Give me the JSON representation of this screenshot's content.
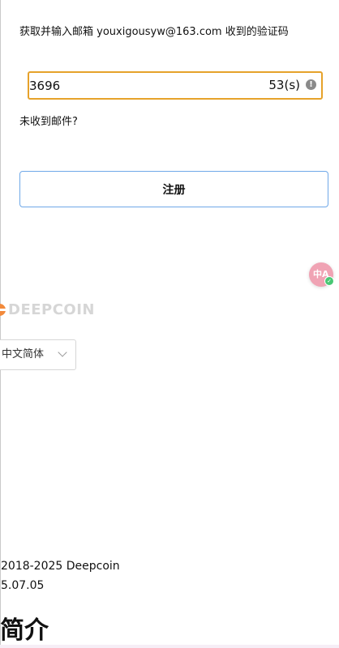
{
  "verification": {
    "instruction": "获取并输入邮箱 youxigousyw@163.com 收到的验证码",
    "code_value": "3696",
    "countdown": "53(s)",
    "no_mail_link": "未收到邮件?",
    "register_label": "注册"
  },
  "translate_widget": {
    "icon": "translate-icon",
    "glyph": "中A",
    "status_icon": "check-icon"
  },
  "brand": {
    "name": "DEEPCOIN",
    "logo_icon": "deepcoin-logo-icon"
  },
  "language_select": {
    "selected": "中文简体",
    "icon": "chevron-down-icon"
  },
  "footer": {
    "copyright": "2018-2025 Deepcoin",
    "version": "5.07.05",
    "section_heading": "简介"
  },
  "colors": {
    "input_border": "#e6a22a",
    "button_border": "#6fa8e8",
    "brand_accent": "#f28a3b",
    "brand_text": "#d6d6d6",
    "translate_bubble": "#f0a3b4",
    "status_ok": "#48c774"
  }
}
